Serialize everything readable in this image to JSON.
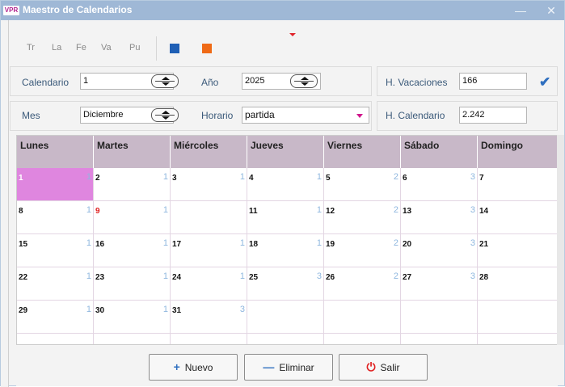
{
  "window": {
    "logo": "VPR",
    "title": "Maestro de Calendarios",
    "minimize": "—",
    "close": "✕"
  },
  "toolbar": {
    "nav_days": [
      "Tr",
      "La",
      "Fe",
      "Va",
      "Pu"
    ],
    "icons": [
      "blue-square-icon",
      "orange-square-icon"
    ],
    "colors": {
      "blue": "#1f5fb5",
      "orange": "#ef6a16"
    }
  },
  "form": {
    "calendario": {
      "label": "Calendario",
      "value": "1"
    },
    "anio": {
      "label": "Año",
      "value": "2025"
    },
    "vacaciones": {
      "label": "H. Vacaciones",
      "value": "166"
    },
    "mes": {
      "label": "Mes",
      "value": "Diciembre"
    },
    "horario": {
      "label": "Horario",
      "value": "partida"
    },
    "h_calendario": {
      "label": "H. Calendario",
      "value": "2.242"
    }
  },
  "calendar": {
    "headers": [
      "Lunes",
      "Martes",
      "Miércoles",
      "Jueves",
      "Viernes",
      "Sábado",
      "Domingo"
    ],
    "selected_color": "#df86df",
    "weeks": [
      [
        {
          "day": "1",
          "count": "1",
          "selected": true
        },
        {
          "day": "2",
          "count": "1"
        },
        {
          "day": "3",
          "count": "1"
        },
        {
          "day": "4",
          "count": "1"
        },
        {
          "day": "5",
          "count": "2"
        },
        {
          "day": "6",
          "count": "3"
        },
        {
          "day": "7",
          "count": ""
        }
      ],
      [
        {
          "day": "8",
          "count": "1"
        },
        {
          "day": "9",
          "count": "1",
          "red": true
        },
        {
          "day": "",
          "count": ""
        },
        {
          "day": "11",
          "count": "1"
        },
        {
          "day": "12",
          "count": "2"
        },
        {
          "day": "13",
          "count": "3"
        },
        {
          "day": "14",
          "count": ""
        }
      ],
      [
        {
          "day": "15",
          "count": "1"
        },
        {
          "day": "16",
          "count": "1"
        },
        {
          "day": "17",
          "count": "1"
        },
        {
          "day": "18",
          "count": "1"
        },
        {
          "day": "19",
          "count": "2"
        },
        {
          "day": "20",
          "count": "3"
        },
        {
          "day": "21",
          "count": ""
        }
      ],
      [
        {
          "day": "22",
          "count": "1"
        },
        {
          "day": "23",
          "count": "1"
        },
        {
          "day": "24",
          "count": "1"
        },
        {
          "day": "25",
          "count": "3"
        },
        {
          "day": "26",
          "count": "2"
        },
        {
          "day": "27",
          "count": "3"
        },
        {
          "day": "28",
          "count": ""
        }
      ],
      [
        {
          "day": "29",
          "count": "1"
        },
        {
          "day": "30",
          "count": "1"
        },
        {
          "day": "31",
          "count": "3"
        },
        {
          "day": "",
          "count": ""
        },
        {
          "day": "",
          "count": ""
        },
        {
          "day": "",
          "count": ""
        },
        {
          "day": "",
          "count": ""
        }
      ],
      [
        {
          "day": "",
          "count": ""
        },
        {
          "day": "",
          "count": ""
        },
        {
          "day": "",
          "count": ""
        },
        {
          "day": "",
          "count": ""
        },
        {
          "day": "",
          "count": ""
        },
        {
          "day": "",
          "count": ""
        },
        {
          "day": "",
          "count": ""
        }
      ]
    ]
  },
  "buttons": {
    "nuevo": {
      "icon": "+",
      "label": "Nuevo"
    },
    "eliminar": {
      "icon": "—",
      "label": "Eliminar"
    },
    "salir": {
      "icon": "⏻",
      "label": "Salir"
    }
  }
}
